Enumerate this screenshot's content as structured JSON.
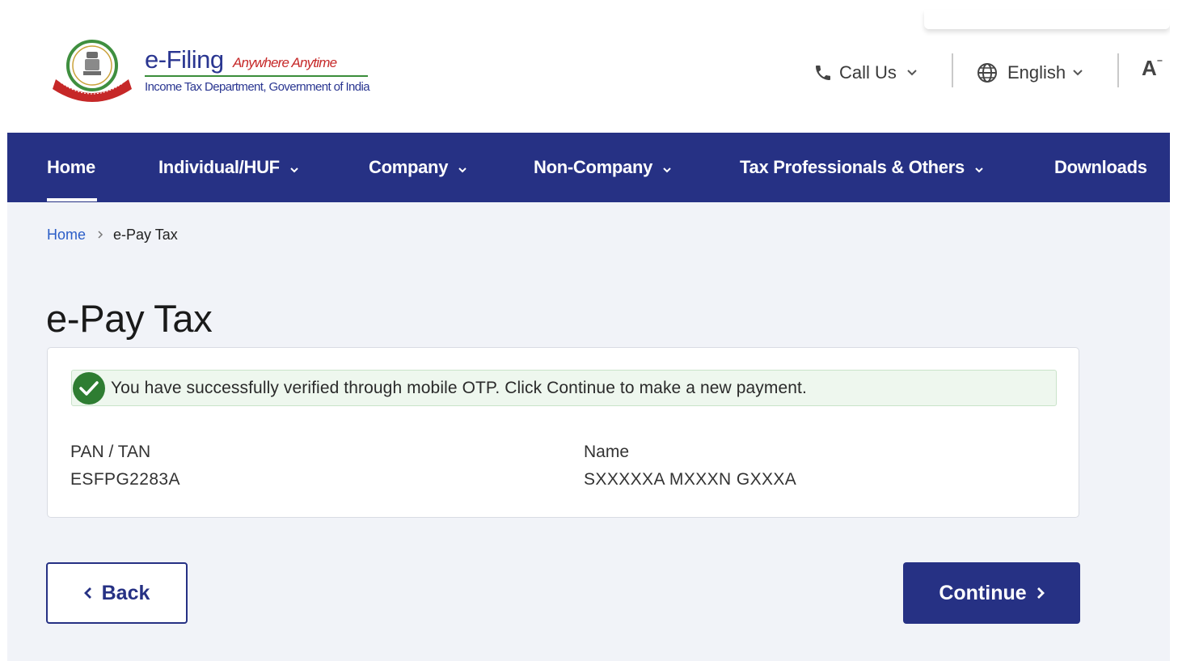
{
  "header": {
    "logo_title": "e-Filing",
    "logo_tagline": "Anywhere Anytime",
    "logo_subtitle": "Income Tax Department, Government of India",
    "call_us": "Call Us",
    "language": "English",
    "font_size_icon": "A"
  },
  "nav": {
    "items": [
      {
        "label": "Home",
        "icon": "none"
      },
      {
        "label": "Individual/HUF",
        "icon": "chevron-down-icon"
      },
      {
        "label": "Company",
        "icon": "chevron-down-icon"
      },
      {
        "label": "Non-Company",
        "icon": "chevron-down-icon"
      },
      {
        "label": "Tax Professionals & Others",
        "icon": "chevron-down-icon"
      },
      {
        "label": "Downloads",
        "icon": "none"
      }
    ]
  },
  "breadcrumb": {
    "home": "Home",
    "current": "e-Pay Tax"
  },
  "page": {
    "title": "e-Pay Tax"
  },
  "alert": {
    "message": "You have successfully verified through mobile OTP. Click Continue to make a new payment.",
    "icon": "check-circle-icon",
    "color": "#2e7d32"
  },
  "details": {
    "pan_label": "PAN / TAN",
    "pan_value": "ESFPG2283A",
    "name_label": "Name",
    "name_value": "SXXXXXA MXXXN GXXXA"
  },
  "actions": {
    "back_label": "Back",
    "continue_label": "Continue"
  },
  "colors": {
    "primary": "#263184",
    "link": "#2b5dc7",
    "success": "#2e7d32",
    "page_bg": "#f1f3f8"
  }
}
